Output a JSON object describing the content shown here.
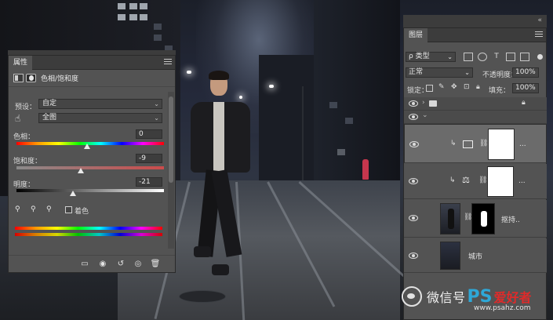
{
  "properties_panel": {
    "tab_label": "属性",
    "adjustment_title": "色相/饱和度",
    "preset_label": "预设：",
    "preset_value": "自定",
    "channel_value": "全图",
    "hue_label": "色相：",
    "hue_value": "0",
    "saturation_label": "饱和度：",
    "saturation_value": "-9",
    "lightness_label": "明度：",
    "lightness_value": "-21",
    "colorize_label": "着色",
    "colorize_checked": false
  },
  "layers_panel": {
    "tab_label": "图层",
    "filter_label": "ρ 类型",
    "blend_mode": "正常",
    "opacity_label": "不透明度：",
    "opacity_value": "100%",
    "lock_label": "锁定：",
    "fill_label": "填充：",
    "fill_value": "100%",
    "layers": [
      {
        "name": "",
        "kind": "group"
      },
      {
        "name": "",
        "kind": "expanded-group"
      },
      {
        "name": "...",
        "kind": "hue-saturation"
      },
      {
        "name": "...",
        "kind": "balance"
      },
      {
        "name": "抠持..",
        "kind": "person"
      },
      {
        "name": "城市",
        "kind": "background"
      }
    ]
  },
  "watermark": {
    "text": "微信号",
    "ps": "PS",
    "cn": "爱好者",
    "url": "www.psahz.com"
  },
  "colors": {
    "panel_bg": "#535353",
    "tab_bar": "#3c3c3c",
    "selected_layer": "#6b6b6b",
    "ps_blue": "#2ea8d8"
  },
  "icons": [
    "adjustment-icon",
    "mask-icon",
    "hand-icon",
    "eyedropper-icon",
    "eye-icon",
    "link-icon",
    "trash-icon",
    "lock-icon",
    "folder-icon"
  ]
}
